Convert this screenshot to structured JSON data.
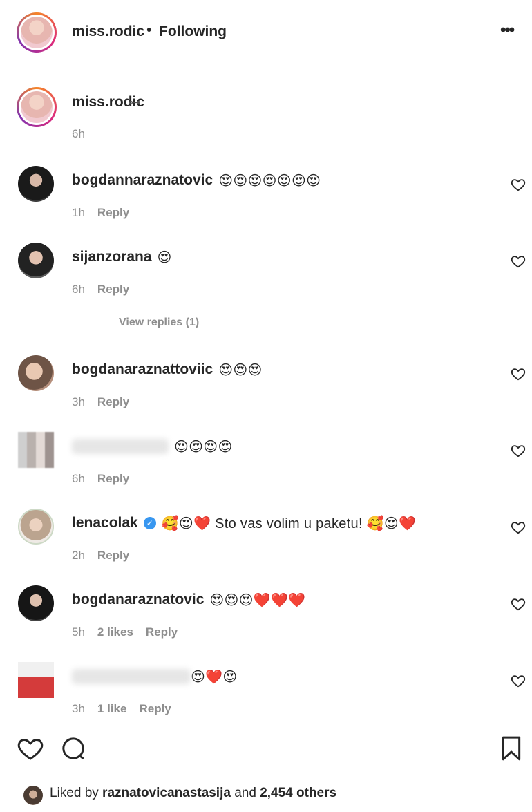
{
  "header": {
    "username": "miss.rodic",
    "separator": "•",
    "follow_status": "Following",
    "more_glyph": "•••"
  },
  "caption": {
    "username": "miss.rodic",
    "glyph": "⊶",
    "time": "6h"
  },
  "comments": [
    {
      "username": "bogdannaraznatovic",
      "text": "😍😍😍😍😍😍😍",
      "time": "1h",
      "likes": "",
      "reply": "Reply",
      "blurred": false,
      "verified": false
    },
    {
      "username": "sijanzorana",
      "text": "😍",
      "time": "6h",
      "likes": "",
      "reply": "Reply",
      "blurred": false,
      "verified": false
    },
    {
      "username": "bogdanaraznattoviic",
      "text": "😍😍😍",
      "time": "3h",
      "likes": "",
      "reply": "Reply",
      "blurred": false,
      "verified": false
    },
    {
      "username": "",
      "text": "😍😍😍😍",
      "time": "6h",
      "likes": "",
      "reply": "Reply",
      "blurred": true,
      "verified": false
    },
    {
      "username": "lenacolak",
      "text": "🥰😍❤️ Sto vas volim u paketu! 🥰😍❤️",
      "time": "2h",
      "likes": "",
      "reply": "Reply",
      "blurred": false,
      "verified": true
    },
    {
      "username": "bogdanaraznatovic",
      "text": "😍😍😍❤️❤️❤️",
      "time": "5h",
      "likes": "2 likes",
      "reply": "Reply",
      "blurred": false,
      "verified": false
    },
    {
      "username": "",
      "text": "😍❤️😍",
      "time": "3h",
      "likes": "1 like",
      "reply": "Reply",
      "blurred": true,
      "verified": false
    }
  ],
  "view_replies": "View replies (1)",
  "verified_glyph": "✓",
  "footer": {
    "liked_by_prefix": "Liked by ",
    "liked_by_user": "raznatovicanastasija",
    "liked_by_mid": " and ",
    "liked_by_others": "2,454 others"
  },
  "icons": {
    "like": "heart-outline-icon",
    "comment": "comment-bubble-icon",
    "save": "bookmark-icon",
    "comment_like": "small-heart-icon"
  }
}
